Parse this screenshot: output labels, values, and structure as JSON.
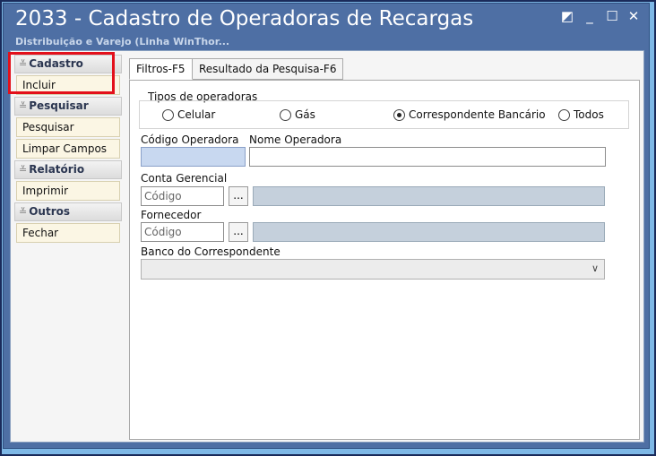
{
  "window": {
    "title": "2033 - Cadastro de Operadoras de Recargas",
    "subtitle": "Distribuição e Varejo (Linha WinThor...",
    "controls": {
      "restore": "◩",
      "minimize": "_",
      "maximize": "☐",
      "close": "✕"
    }
  },
  "sidebar": {
    "cadastro": {
      "header": "Cadastro",
      "items": [
        "Incluir"
      ]
    },
    "pesquisar": {
      "header": "Pesquisar",
      "items": [
        "Pesquisar",
        "Limpar Campos"
      ]
    },
    "relatorio": {
      "header": "Relatório",
      "items": [
        "Imprimir"
      ]
    },
    "outros": {
      "header": "Outros",
      "items": [
        "Fechar"
      ]
    },
    "chevron": "≚"
  },
  "tabs": [
    "Filtros-F5",
    "Resultado da Pesquisa-F6"
  ],
  "form": {
    "tipos_label": "Tipos de operadoras",
    "radios": [
      {
        "label": "Celular",
        "selected": false
      },
      {
        "label": "Gás",
        "selected": false
      },
      {
        "label": "Correspondente Bancário",
        "selected": true
      },
      {
        "label": "Todos",
        "selected": false
      }
    ],
    "codigo_operadora_label": "Código Operadora",
    "nome_operadora_label": "Nome Operadora",
    "codigo_operadora_value": "",
    "nome_operadora_value": "",
    "conta_gerencial_label": "Conta Gerencial",
    "conta_codigo_placeholder": "Código",
    "fornecedor_label": "Fornecedor",
    "fornecedor_codigo_placeholder": "Código",
    "browse_label": "...",
    "banco_label": "Banco do Correspondente",
    "banco_value": ""
  },
  "colors": {
    "highlight": "#e3101b",
    "window_bg": "#4e6fa4",
    "frame": "#7eb8e6"
  }
}
